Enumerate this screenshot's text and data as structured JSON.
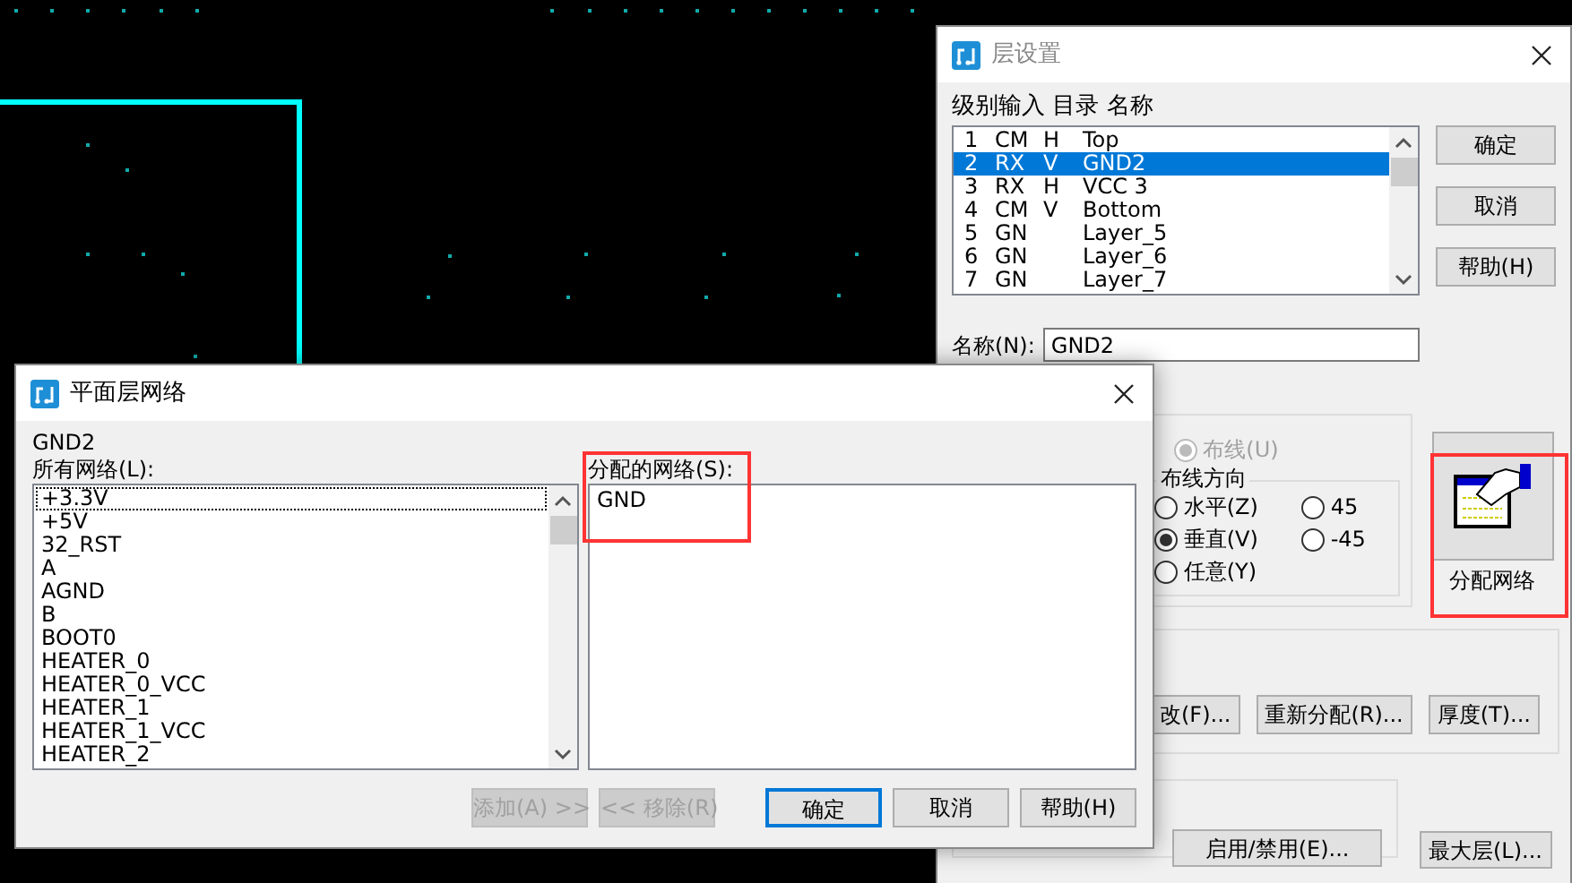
{
  "layer_dialog": {
    "title": "层设置",
    "columns_label": "级别输入 目录 名称",
    "layers": [
      {
        "level": "1",
        "type": "CM",
        "direction": "H",
        "name": "Top",
        "selected": false
      },
      {
        "level": "2",
        "type": "RX",
        "direction": "V",
        "name": "GND2",
        "selected": true
      },
      {
        "level": "3",
        "type": "RX",
        "direction": "H",
        "name": "VCC 3",
        "selected": false
      },
      {
        "level": "4",
        "type": "CM",
        "direction": "V",
        "name": "Bottom",
        "selected": false
      },
      {
        "level": "5",
        "type": "GN",
        "name": "Layer_5",
        "selected": false
      },
      {
        "level": "6",
        "type": "GN",
        "name": "Layer_6",
        "selected": false
      },
      {
        "level": "7",
        "type": "GN",
        "name": "Layer_7",
        "selected": false
      }
    ],
    "buttons": [
      "确定",
      "取消",
      "帮助(H)"
    ],
    "name_label": "名称(N):",
    "name_value": "GND2",
    "routing": {
      "label": "布线(U)",
      "checked": true,
      "disabled": true
    },
    "direction_group": {
      "title": "布线方向",
      "options": [
        {
          "label": "水平(Z)",
          "selected": false
        },
        {
          "label": "垂直(V)",
          "selected": true
        },
        {
          "label": "任意(Y)",
          "selected": false
        },
        {
          "label": "45",
          "selected": false
        },
        {
          "label": "-45",
          "selected": false
        }
      ]
    },
    "assign_button": "分配网络",
    "action_buttons": [
      "改(F)...",
      "重新分配(R)...",
      "厚度(T)..."
    ],
    "bottom_buttons": [
      "启用/禁用(E)...",
      "最大层(L)..."
    ]
  },
  "net_dialog": {
    "title": "平面层网络",
    "layer": "GND2",
    "all_label": "所有网络(L):",
    "all_nets": [
      {
        "name": "+3.3V",
        "focused": true
      },
      {
        "name": "+5V",
        "focused": false
      },
      {
        "name": "32_RST",
        "focused": false
      },
      {
        "name": "A",
        "focused": false
      },
      {
        "name": "AGND",
        "focused": false
      },
      {
        "name": "B",
        "focused": false
      },
      {
        "name": "BOOT0",
        "focused": false
      },
      {
        "name": "HEATER_0",
        "focused": false
      },
      {
        "name": "HEATER_0_VCC",
        "focused": false
      },
      {
        "name": "HEATER_1",
        "focused": false
      },
      {
        "name": "HEATER_1_VCC",
        "focused": false
      },
      {
        "name": "HEATER_2",
        "focused": false
      }
    ],
    "assigned_label": "分配的网络(S):",
    "assigned_nets": [
      "GND"
    ],
    "buttons": [
      {
        "label": "添加(A) >>",
        "disabled": true,
        "default": false
      },
      {
        "label": "<< 移除(R)",
        "disabled": true,
        "default": false
      },
      {
        "label": "确定",
        "disabled": false,
        "default": true
      },
      {
        "label": "取消",
        "disabled": false,
        "default": false
      },
      {
        "label": "帮助(H)",
        "disabled": false,
        "default": false
      }
    ]
  }
}
